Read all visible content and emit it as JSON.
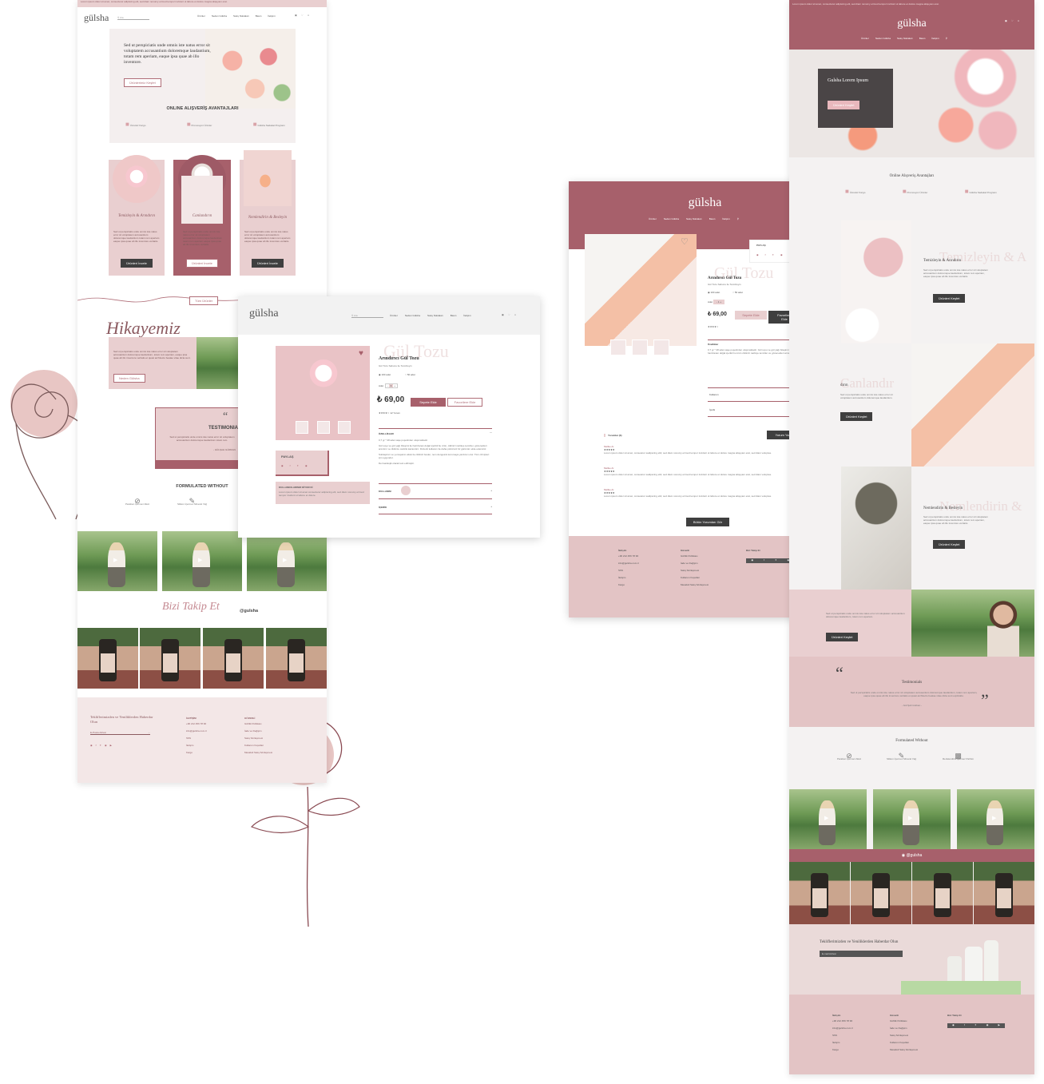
{
  "brand": "gülsha",
  "colors": {
    "rose": "#a7606b",
    "blush": "#e9cfd0",
    "pale": "#f3e7e7",
    "dark": "#3f3f3f"
  },
  "mockup_a": {
    "topbar": "Lorem ipsum dolor sit amet, consectetur adipiscing elit, sed diam nonumy eirmod tempor invidunt ut labore et dolore magna aliquyam erat.",
    "logo": "gülsha",
    "search_placeholder": "Ara",
    "nav": [
      "Ürünler",
      "Neden Gülsha",
      "Satış Noktaları",
      "Basın",
      "İletişim"
    ],
    "hero_text": "Sed ut perspiciatis unde omnis iste natus error sit voluptatem accusantium doloremque laudantium, totam rem aperiam, eaque ipsa quae ab illo inventore.",
    "hero_button": "Ürünlerimiz Keşfet",
    "advantages_title": "ONLINE ALIŞVERİŞ AVANTAJLARI",
    "advantages": [
      "Ücretsiz Kargo",
      "Promosyon Ürünler",
      "Gülsha Sadakat Programı"
    ],
    "categories": [
      {
        "title": "Temizleyin & Arındırın",
        "text": "Sed ut perspiciatis unde omnis iste natus error sit voluptatem accusantium doloremque laudantium totam rem aperiam eaque ipsa quae ab illo inventore veritatis.",
        "button": "Ürünleri İncele"
      },
      {
        "title": "Canlandırın",
        "text": "Sed ut perspiciatis unde omnis iste natus error sit voluptatem accusantium doloremque laudantium totam rem aperiam eaque ipsa quae ab illo inventore veritatis.",
        "button": "Ürünleri İncele"
      },
      {
        "title": "Nemlendirin & Besleyin",
        "text": "Sed ut perspiciatis unde omnis iste natus error sit voluptatem accusantium doloremque laudantium totam rem aperiam eaque ipsa quae ab illo inventore veritatis.",
        "button": "Ürünleri İncele"
      }
    ],
    "all_products_button": "Tüm Ürünler",
    "story_title": "Hikayemiz",
    "story_text": "Sed ut perspiciatis unde omnis iste natus error sit voluptatem accusantium doloremque laudantium, totam rem aperiam, eaque ipsa quae ab illo inventore veritatis et quasi architecto beatae vitae dicta sunt.",
    "story_button": "Neden Gülsha",
    "testimonial_title": "TESTIMONIA",
    "testimonial_text": "Sed ut perspiciatis unde omnis iste natus error sit voluptatem accusantium doloremque laudantium totam rem.",
    "testimonial_author": "- GÜLŞAH GÜRKAN",
    "formulated_title": "FORMULATED WITHOUT",
    "formulated_items": [
      "Paraben İçermez Alkol",
      "Silikon İçermez Mineral Yağ"
    ],
    "follow_title": "Bizi Takip Et",
    "follow_handle": "@gulsha",
    "newsletter_title": "Tekliflerimizden ve Yeniliklerden Haberdar Olun",
    "newsletter_placeholder": "E-Posta Adresi",
    "footer_col1_title": "İLETİŞİM",
    "footer_col1": [
      "+90 212 456 78 90",
      "info@gulsha.com.tr",
      "SSS",
      "İletişim",
      "Kargo"
    ],
    "footer_col2_title": "GÜVENLİ",
    "footer_col2": [
      "Gizlilik Politikası",
      "İade ve Değişim",
      "Satış Sözleşmesi",
      "Kullanım Koşulları",
      "Mesafeli Satış Sözleşmesi"
    ]
  },
  "mockup_b": {
    "logo": "gülsha",
    "search_placeholder": "Ara",
    "nav": [
      "Ürünler",
      "Neden Gülsha",
      "Satış Noktaları",
      "Basın",
      "İletişim"
    ],
    "bg_title": "Gül Tozu",
    "product_name": "Arındırıcı Gül Tozu",
    "product_sub": "Gül Tozu Sabunu ile Temizleyin",
    "size_options": [
      "100 adet",
      "50 adet"
    ],
    "qty_label": "Adet",
    "qty_value": "1",
    "price": "₺ 69,00",
    "add_button": "Sepete Ekle",
    "fav_button": "Favorilere Ekle",
    "reviews_count": "12 Yorum",
    "share_title": "PAYLAŞ",
    "usage_box_title": "KULLANICILARIMIZ DİYOR Kİ",
    "usage_box_text": "Lorem ipsum dolor sit amet consectetur adipiscing elit, sed diam nonumy eirmod tempor invidunt ut labore et dolore.",
    "features_title": "ÖZELLİKLER",
    "features_text_1": "0,7 gr * 28 adet saşe poşetinden oluşmaktadır.",
    "features_text_2": "Gül suyu ve gül yağı bileşimi ile hazırlanan doğal içerikli bu ürün, cildinizi nazikçe temizler, gözenekleri arındırır ve cildinize canlılık kazandırır. Düzenli kullanım ile daha pürüzsüz bir görünüm elde edersiniz.",
    "features_text_3": "Sıkılaştırıcı ve yumuşatıcı etkisi ile cildinizi besler, nem dengesini korumaya yardımcı olur. Tüm cilt tipleri için uygundur.",
    "features_text_4": "Dermatolojik olarak test edilmiştir.",
    "usage_title": "KULLANIM",
    "contents_title": "İÇERİK"
  },
  "mockup_c": {
    "logo": "gülsha",
    "nav": [
      "Ürünler",
      "Neden Gülsha",
      "Satış Noktaları",
      "Basın",
      "İletişim"
    ],
    "bg_title": "Gül Tozu",
    "product_name": "Arındırıcı Gül Tozu",
    "product_sub": "Gül Tozu Sabunu ile Temizleyin",
    "size_options": [
      "100 adet",
      "50 adet"
    ],
    "qty_label": "Adet",
    "price": "₺ 69,00",
    "add_button": "Sepete Ekle",
    "fav_button": "Favorilere Ekle",
    "share_title": "PAYLAŞ",
    "features_title": "Özellikler",
    "features_text": "0,7 gr * 28 adet saşe poşetinden oluşmaktadır. Gül suyu ve gül yağı bileşimi ile hazırlanan doğal içerikli bu ürün cildinizi nazikçe temizler ve gözenekleri arındırır.",
    "usage_title": "Kullanım",
    "contents_title": "İçerik",
    "reviews_title": "Yorumlar (3)",
    "write_review": "Yorum Yaz",
    "review_author": "Melike Ar.",
    "review_text": "Lorem ipsum dolor sit amet, consetetur sadipscing elitr, sed diam nonumy eirmod tempor invidunt ut labore et dolore magna aliquyam erat, sed diam voluptua.",
    "more_reviews": "Bütün Yorumları Gör",
    "footer_col1_title": "İletişim",
    "footer_col1": [
      "+90 212 456 78 90",
      "info@gulsha.com.tr",
      "SSS",
      "İletişim",
      "Kargo"
    ],
    "footer_col2_title": "Güvenli",
    "footer_col2": [
      "Gizlilik Politikası",
      "İade ve Değişim",
      "Satış Sözleşmesi",
      "Kullanım Koşulları",
      "Mesafeli Satış Sözleşmesi"
    ],
    "footer_col3_title": "Bizi Takip Et"
  },
  "mockup_d": {
    "topbar": "Lorem ipsum dolor sit amet, consectetur adipiscing elit, sed diam nonumy eirmod tempor invidunt ut labore et dolore magna aliquyam erat.",
    "logo": "gülsha",
    "nav": [
      "Ürünler",
      "Neden Gülsha",
      "Satış Noktaları",
      "Basın",
      "İletişim"
    ],
    "hero_title": "Gulsha Lorem Ipsum",
    "hero_button": "Ürünleri Keşfet",
    "advantages_title": "Online Alışveriş Avantajları",
    "advantages": [
      "Ücretsiz Kargo",
      "Promosyon Ürünler",
      "Gülsha Sadakat Programı"
    ],
    "sections": [
      {
        "title": "Temizleyin & Arındırın",
        "bg": "Temizleyin & A",
        "text": "Sed ut perspiciatis unde omnis iste natus error sit voluptatem accusantium doloremque laudantium, totam rem aperiam, eaque ipsa quae ab illo inventore veritatis.",
        "button": "Ürünleri Keşfet"
      },
      {
        "title": "dırın",
        "bg": "Canlandır",
        "text": "Sed ut perspiciatis unde omnis iste natus error sit voluptatem accusantium doloremque laudantium.",
        "button": "Ürünleri Keşfet"
      },
      {
        "title": "Nemlendirin & Besleyin",
        "bg": "Nemlendirin &",
        "text": "Sed ut perspiciatis unde omnis iste natus error sit voluptatem accusantium doloremque laudantium, totam rem aperiam, eaque ipsa quae ab illo inventore veritatis.",
        "button": "Ürünleri Keşfet"
      }
    ],
    "story_text": "Sed ut perspiciatis unde omnis iste natus error sit voluptatem accusantium doloremque laudantium, totam rem aperiam.",
    "story_button": "Ürünleri Keşfet",
    "testimonial_title": "Testimonials",
    "testimonial_text": "Sed ut perspiciatis unde omnis iste natus error sit voluptatem accusantium doloremque laudantium, totam rem aperiam, eaque ipsa quae ab illo inventore veritatis et quasi architecto beatae vitae dicta sunt explicabo.",
    "testimonial_author": "- Gül Şah Gürkan -",
    "formulated_title": "Formulated Without",
    "formulated_items": [
      "Paraben İçermez Alkol",
      "Silikon İçermez Mineral Yağ",
      "Renklendirici İçermez Parfüm"
    ],
    "instagram_handle": "@gulsha",
    "newsletter_title": "Tekliflerimizden ve Yeniliklerden Haberdar Olun",
    "newsletter_placeholder": "E-mail Adresi",
    "footer_col1_title": "İletişim",
    "footer_col1": [
      "+90 212 456 78 90",
      "info@gulsha.com.tr",
      "SSS",
      "İletişim",
      "Kargo"
    ],
    "footer_col2_title": "Güvenli",
    "footer_col2": [
      "Gizlilik Politikası",
      "İade ve Değişim",
      "Satış Sözleşmesi",
      "Kullanım Koşulları",
      "Mesafeli Satış Sözleşmesi"
    ],
    "footer_col3_title": "Bizi Takip Et"
  }
}
